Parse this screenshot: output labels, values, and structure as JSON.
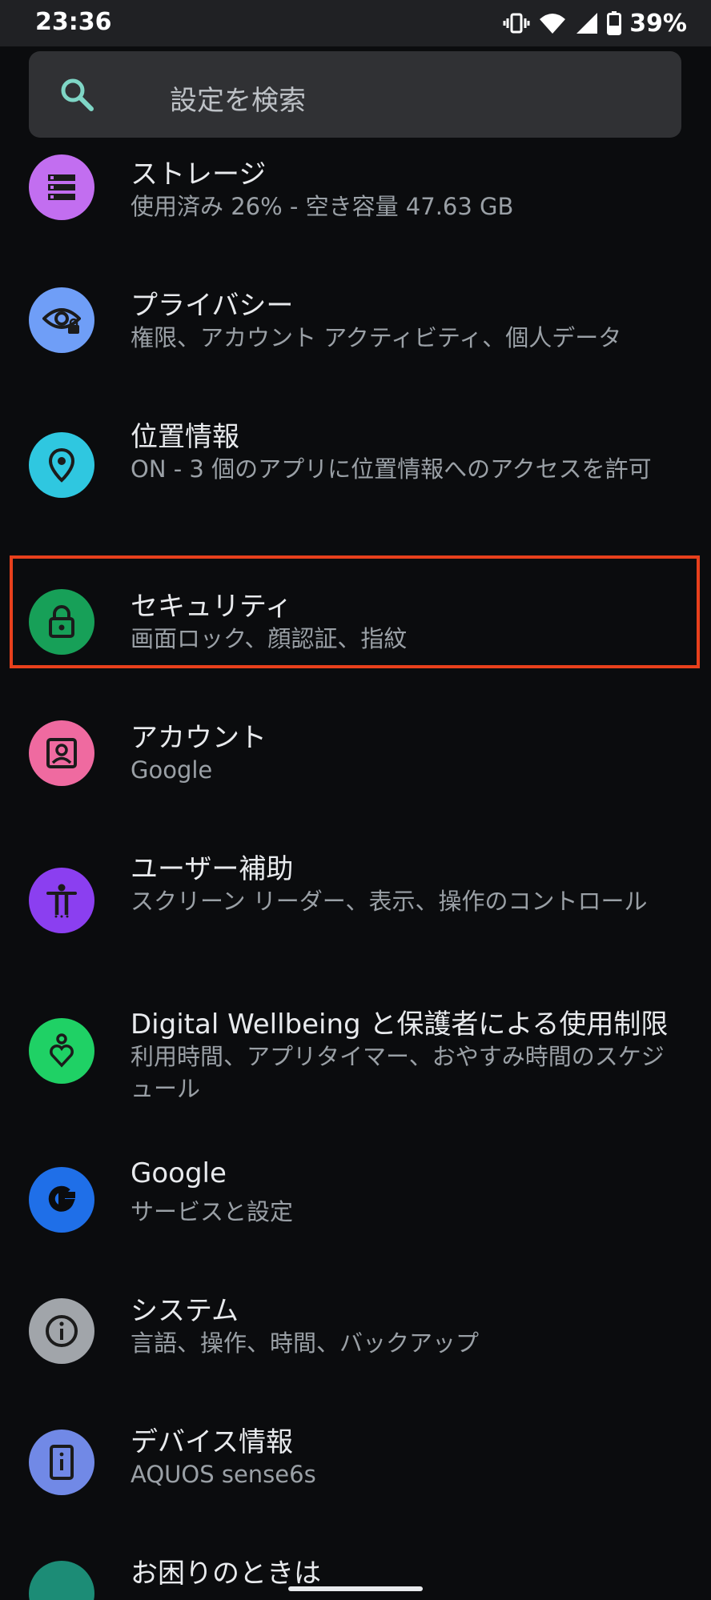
{
  "status_bar": {
    "time": "23:36",
    "battery_percent": "39%",
    "icons": [
      "vibrate-icon",
      "wifi-icon",
      "signal-icon",
      "battery-icon"
    ]
  },
  "search": {
    "placeholder": "設定を検索",
    "icon": "search-icon"
  },
  "settings": [
    {
      "id": "storage",
      "title": "ストレージ",
      "subtitle": "使用済み 26% - 空き容量 47.63 GB",
      "icon": "storage-icon",
      "color": "#c26ef0"
    },
    {
      "id": "privacy",
      "title": "プライバシー",
      "subtitle": "権限、アカウント アクティビティ、個人データ",
      "icon": "privacy-eye-lock-icon",
      "color": "#6f9ef7"
    },
    {
      "id": "location",
      "title": "位置情報",
      "subtitle": "ON - 3 個のアプリに位置情報へのアクセスを許可",
      "icon": "location-pin-icon",
      "color": "#2fc7e0"
    },
    {
      "id": "security",
      "title": "セキュリティ",
      "subtitle": "画面ロック、顔認証、指紋",
      "icon": "lock-icon",
      "color": "#17a058"
    },
    {
      "id": "accounts",
      "title": "アカウント",
      "subtitle": "Google",
      "icon": "account-box-icon",
      "color": "#ef6aa0"
    },
    {
      "id": "accessibility",
      "title": "ユーザー補助",
      "subtitle": "スクリーン リーダー、表示、操作のコントロール",
      "icon": "accessibility-icon",
      "color": "#8b3ff0"
    },
    {
      "id": "digital-wellbeing",
      "title": "Digital Wellbeing と保護者による使用制限",
      "subtitle": "利用時間、アプリタイマー、おやすみ時間のスケジュール",
      "icon": "wellbeing-heart-icon",
      "color": "#1fd165"
    },
    {
      "id": "google",
      "title": "Google",
      "subtitle": "サービスと設定",
      "icon": "google-g-icon",
      "color": "#1f6fe8"
    },
    {
      "id": "system",
      "title": "システム",
      "subtitle": "言語、操作、時間、バックアップ",
      "icon": "info-icon",
      "color": "#a1a5aa"
    },
    {
      "id": "about-device",
      "title": "デバイス情報",
      "subtitle": "AQUOS sense6s",
      "icon": "device-info-icon",
      "color": "#7189e6"
    },
    {
      "id": "help",
      "title": "お困りのときは",
      "subtitle": "",
      "icon": "help-icon",
      "color": "#1c8c76"
    }
  ],
  "highlight_item": "security"
}
